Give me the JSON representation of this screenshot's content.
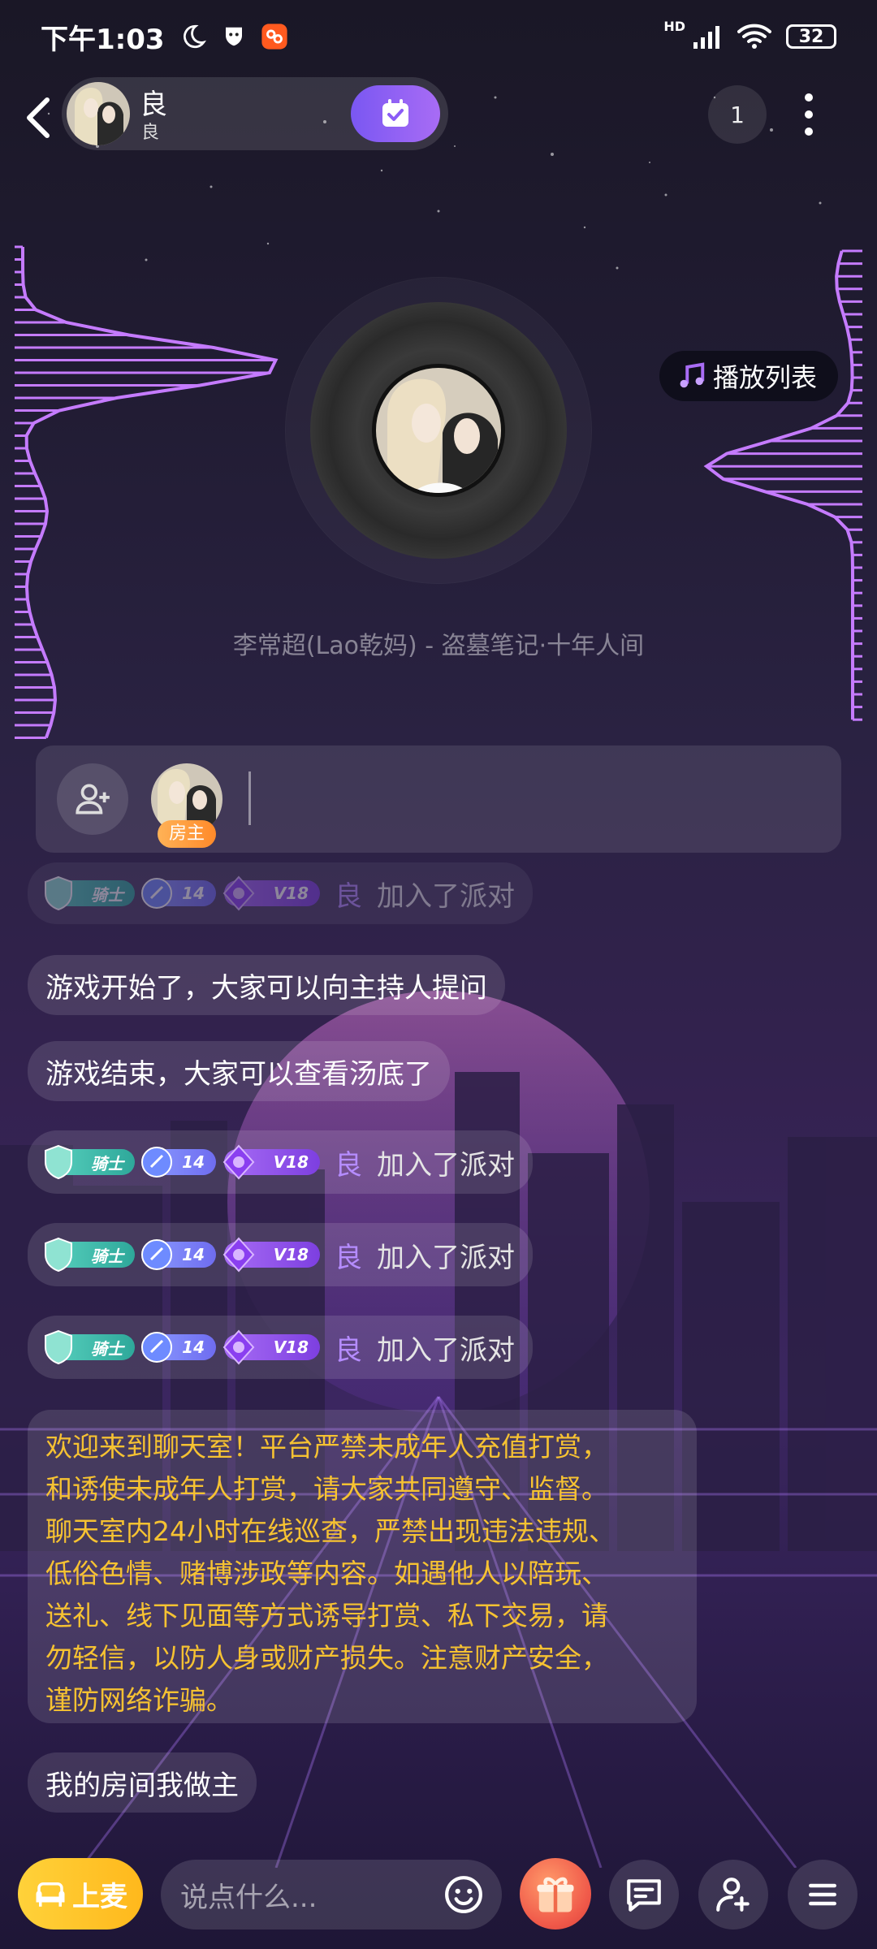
{
  "status_bar": {
    "time": "下午1:03",
    "network": "HD",
    "battery": "32",
    "icons": [
      "moon-icon",
      "mask-icon",
      "app-badge-icon",
      "signal-icon",
      "wifi-icon",
      "battery-icon"
    ]
  },
  "header": {
    "room_name": "良",
    "room_sub": "良",
    "online_count": "1"
  },
  "music": {
    "playlist_label": "播放列表",
    "song": "李常超(Lao乾妈) - 盗墓笔记·十年人间"
  },
  "mic": {
    "host_badge": "房主"
  },
  "messages": [
    {
      "type": "join",
      "knight": "骑士",
      "level": "14",
      "vip": "V18",
      "user": "良",
      "action": "加入了派对"
    },
    {
      "type": "text",
      "text": "游戏开始了，大家可以向主持人提问"
    },
    {
      "type": "text",
      "text": "游戏结束，大家可以查看汤底了"
    },
    {
      "type": "join",
      "knight": "骑士",
      "level": "14",
      "vip": "V18",
      "user": "良",
      "action": "加入了派对"
    },
    {
      "type": "join",
      "knight": "骑士",
      "level": "14",
      "vip": "V18",
      "user": "良",
      "action": "加入了派对"
    },
    {
      "type": "join",
      "knight": "骑士",
      "level": "14",
      "vip": "V18",
      "user": "良",
      "action": "加入了派对"
    }
  ],
  "notice_lines": [
    "欢迎来到聊天室！平台严禁未成年人充值打赏，",
    "和诱使未成年人打赏，请大家共同遵守、监督。",
    "聊天室内24小时在线巡查，严禁出现违法违规、",
    "低俗色情、赌博涉政等内容。如遇他人以陪玩、",
    "送礼、线下见面等方式诱导打赏、私下交易，请",
    "勿轻信，以防人身或财产损失。注意财产安全，",
    "谨防网络诈骗。"
  ],
  "last_message": "我的房间我做主",
  "bottom_bar": {
    "mic_up_label": "上麦",
    "input_placeholder": "说点什么..."
  },
  "colors": {
    "accent_purple": "#a86cf5",
    "notice_yellow": "#f6c232",
    "mic_up_yellow": "#ffc52a",
    "gift_red": "#f05a4a"
  }
}
